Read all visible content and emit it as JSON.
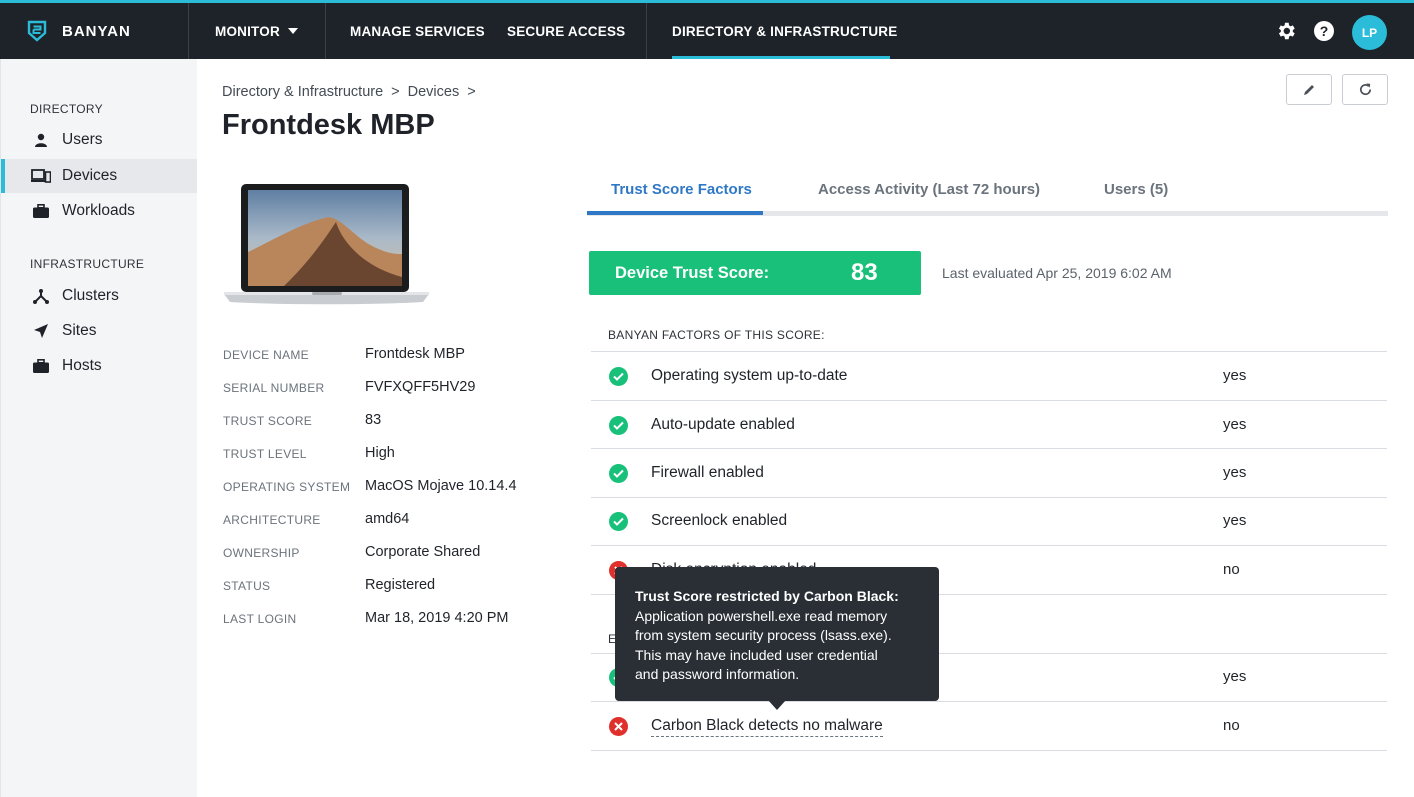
{
  "brand": {
    "name": "BANYAN"
  },
  "nav": {
    "monitor": "MONITOR",
    "manage_services": "MANAGE SERVICES",
    "secure_access": "SECURE ACCESS",
    "directory_infrastructure": "DIRECTORY & INFRASTRUCTURE",
    "active": "DIRECTORY & INFRASTRUCTURE"
  },
  "user": {
    "initials": "LP"
  },
  "sidebar": {
    "directory_heading": "DIRECTORY",
    "directory_items": [
      {
        "label": "Users",
        "icon": "user-icon"
      },
      {
        "label": "Devices",
        "icon": "devices-icon",
        "active": true
      },
      {
        "label": "Workloads",
        "icon": "briefcase-icon"
      }
    ],
    "infrastructure_heading": "INFRASTRUCTURE",
    "infrastructure_items": [
      {
        "label": "Clusters",
        "icon": "cluster-icon"
      },
      {
        "label": "Sites",
        "icon": "location-arrow-icon"
      },
      {
        "label": "Hosts",
        "icon": "briefcase-icon"
      }
    ]
  },
  "breadcrumb": [
    "Directory & Infrastructure",
    ">",
    "Devices",
    ">"
  ],
  "page_title": "Frontdesk MBP",
  "device_details": [
    {
      "label": "DEVICE NAME",
      "value": "Frontdesk MBP"
    },
    {
      "label": "SERIAL NUMBER",
      "value": "FVFXQFF5HV29"
    },
    {
      "label": "TRUST SCORE",
      "value": "83"
    },
    {
      "label": "TRUST LEVEL",
      "value": "High"
    },
    {
      "label": "OPERATING SYSTEM",
      "value": "MacOS Mojave 10.14.4"
    },
    {
      "label": "ARCHITECTURE",
      "value": "amd64"
    },
    {
      "label": "OWNERSHIP",
      "value": "Corporate Shared"
    },
    {
      "label": "STATUS",
      "value": "Registered"
    },
    {
      "label": "LAST LOGIN",
      "value": "Mar 18, 2019 4:20 PM"
    }
  ],
  "tabs": [
    {
      "label": "Trust Score Factors",
      "active": true
    },
    {
      "label": "Access Activity (Last 72 hours)"
    },
    {
      "label": "Users (5)"
    }
  ],
  "trust_score": {
    "label": "Device Trust Score:",
    "value": "83",
    "last_evaluated": "Last evaluated Apr 25, 2019 6:02 AM",
    "color": "#19c07a"
  },
  "banyan_factors": {
    "heading": "BANYAN FACTORS OF THIS SCORE:",
    "rows": [
      {
        "name": "Operating system up-to-date",
        "value": "yes",
        "status": "ok"
      },
      {
        "name": "Auto-update enabled",
        "value": "yes",
        "status": "ok"
      },
      {
        "name": "Firewall enabled",
        "value": "yes",
        "status": "ok"
      },
      {
        "name": "Screenlock enabled",
        "value": "yes",
        "status": "ok"
      },
      {
        "name": "Disk encryption enabled",
        "value": "no",
        "status": "bad"
      }
    ]
  },
  "external_factors": {
    "heading": "E",
    "rows": [
      {
        "name": "",
        "value": "yes",
        "status": "ok"
      },
      {
        "name": "Carbon Black detects no malware",
        "value": "no",
        "status": "bad"
      }
    ]
  },
  "tooltip": {
    "title": "Trust Score restricted by Carbon Black:",
    "lines": [
      "Application powershell.exe read memory",
      "from system security process (lsass.exe).",
      "This may have included user credential",
      "and password information."
    ]
  },
  "colors": {
    "accent": "#2bbcd9",
    "tab_active": "#2f78c6",
    "ok": "#19c07a",
    "bad": "#e0302b",
    "topbar": "#1e2329"
  }
}
